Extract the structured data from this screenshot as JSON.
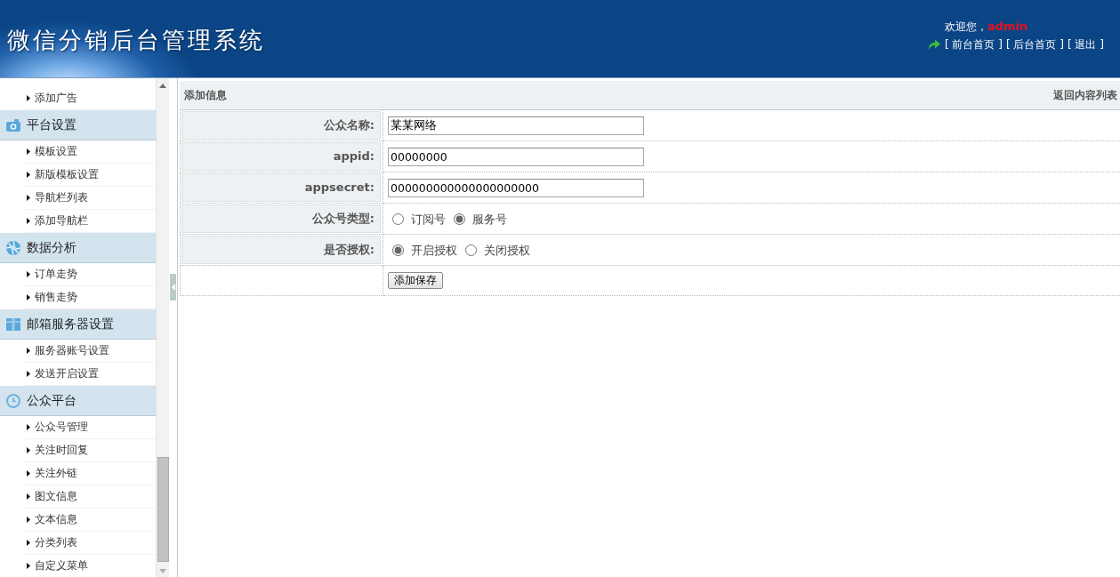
{
  "header": {
    "title": "微信分销后台管理系统",
    "welcome": "欢迎您，",
    "user": "admin",
    "links": [
      "[ 前台首页 ]",
      "[ 后台首页 ]",
      "[ 退出 ]"
    ]
  },
  "sidebar": {
    "groups": [
      {
        "items": [
          "添加广告"
        ]
      },
      {
        "title": "平台设置",
        "items": [
          "模板设置",
          "新版模板设置",
          "导航栏列表",
          "添加导航栏"
        ]
      },
      {
        "title": "数据分析",
        "items": [
          "订单走势",
          "销售走势"
        ]
      },
      {
        "title": "邮箱服务器设置",
        "items": [
          "服务器账号设置",
          "发送开启设置"
        ]
      },
      {
        "title": "公众平台",
        "items": [
          "公众号管理",
          "关注时回复",
          "关注外链",
          "图文信息",
          "文本信息",
          "分类列表",
          "自定义菜单"
        ]
      }
    ]
  },
  "panel": {
    "title": "添加信息",
    "back_link": "返回内容列表"
  },
  "form": {
    "rows": [
      {
        "kind": "text",
        "label": "公众名称:",
        "value": "某某网络"
      },
      {
        "kind": "text",
        "label": "appid:",
        "value": "00000000"
      },
      {
        "kind": "text",
        "label": "appsecret:",
        "value": "000000000000000000000"
      },
      {
        "kind": "radio",
        "label": "公众号类型:",
        "options": [
          {
            "label": "订阅号",
            "selected": false
          },
          {
            "label": "服务号",
            "selected": true
          }
        ]
      },
      {
        "kind": "radio",
        "label": "是否授权:",
        "options": [
          {
            "label": "开启授权",
            "selected": true
          },
          {
            "label": "关闭授权",
            "selected": false
          }
        ]
      },
      {
        "kind": "button",
        "label": "添加保存"
      }
    ]
  }
}
